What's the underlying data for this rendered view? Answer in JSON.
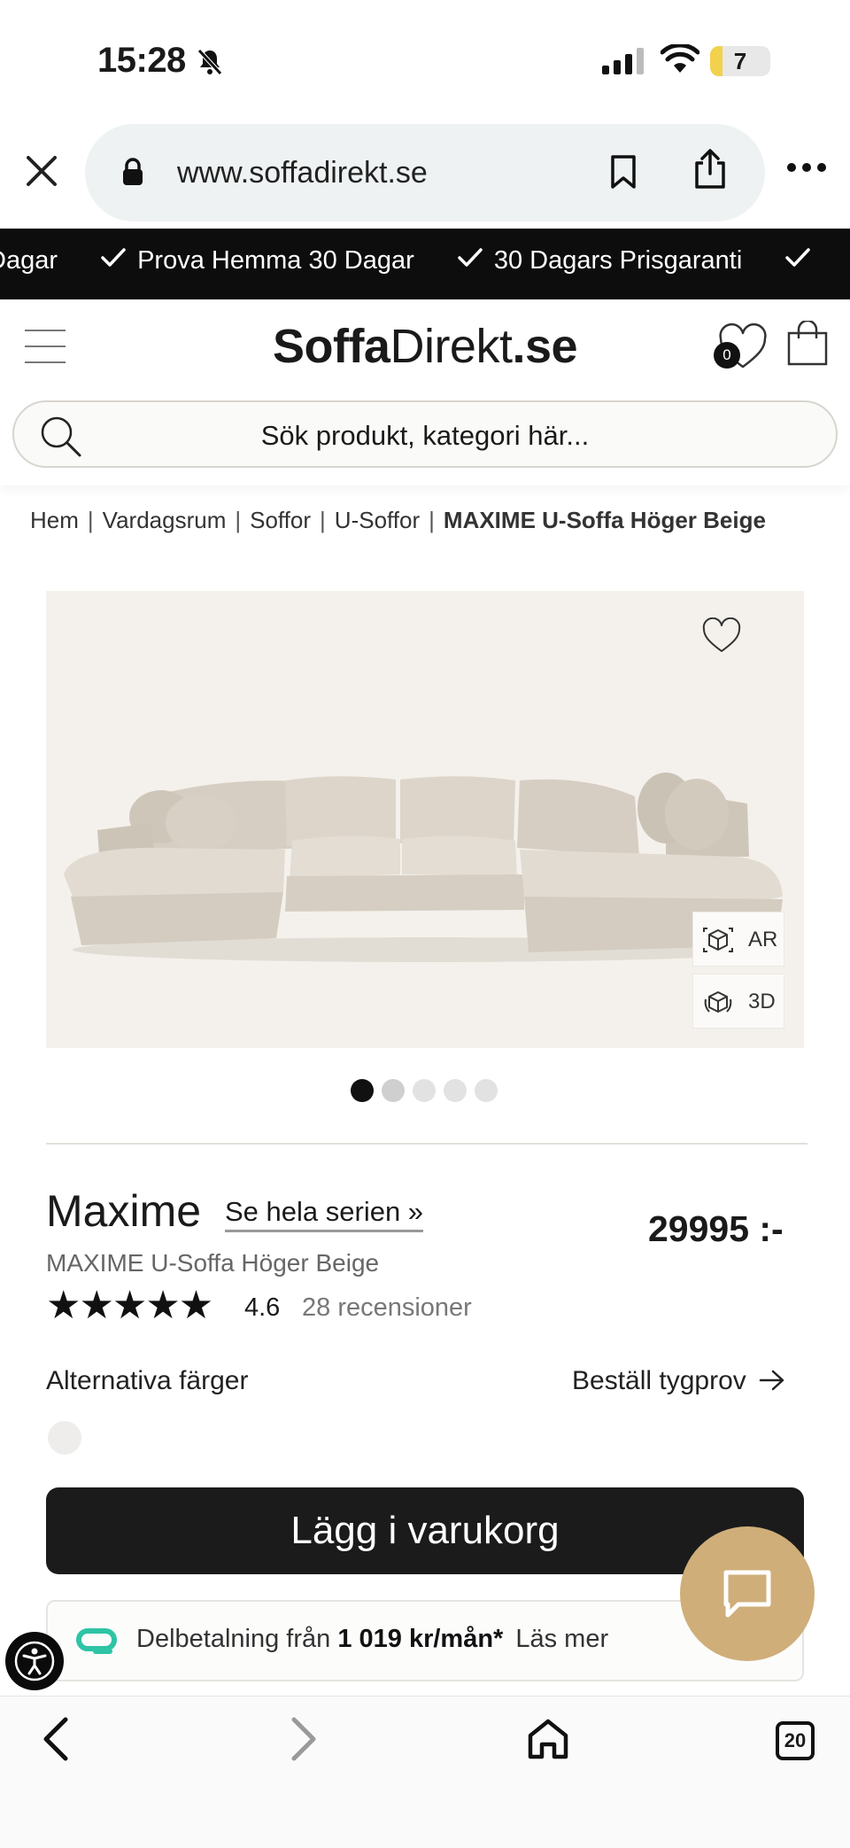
{
  "status_bar": {
    "time": "15:28",
    "battery": "7"
  },
  "browser": {
    "url": "www.soffadirekt.se",
    "tab_count": "20"
  },
  "marquee": {
    "items": [
      "Dagar",
      "Prova Hemma 30 Dagar",
      "30 Dagars Prisgaranti"
    ]
  },
  "header": {
    "logo_bold": "Soffa",
    "logo_regular": "Direkt",
    "logo_suffix": ".se",
    "wishlist_count": "0",
    "search_placeholder": "Sök produkt, kategori här..."
  },
  "breadcrumb": {
    "items": [
      "Hem",
      "Vardagsrum",
      "Soffor",
      "U-Soffor"
    ],
    "current": "MAXIME U-Soffa Höger Beige"
  },
  "gallery": {
    "ar_label": "AR",
    "td_label": "3D",
    "image_count": 5,
    "active_index": 0
  },
  "product": {
    "name": "Maxime",
    "series_link": "Se hela serien »",
    "price": "29995 :-",
    "variant": "MAXIME U-Soffa Höger Beige",
    "rating": "4.6",
    "stars": 5,
    "reviews": "28 recensioner",
    "alt_colors_label": "Alternativa färger",
    "fabric_sample_link": "Beställ tygprov",
    "add_to_cart": "Lägg i varukorg"
  },
  "finance": {
    "prefix": "Delbetalning från",
    "amount": "1 019 kr/mån*",
    "link": "Läs mer"
  },
  "colors": {
    "accent": "#cfae79",
    "dark": "#1b1b1b",
    "finance_logo": "#2ec4a6"
  }
}
